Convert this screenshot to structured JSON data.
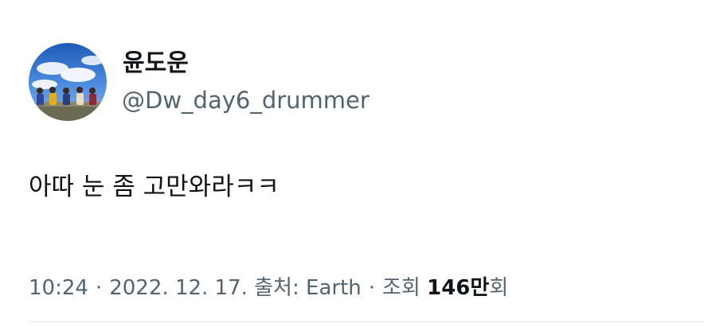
{
  "tweet": {
    "author": {
      "display_name": "윤도운",
      "handle": "@Dw_day6_drummer"
    },
    "text": "아따 눈 좀 고만와라ㅋㅋ",
    "meta": {
      "time": "10:24",
      "date": "2022. 12. 17.",
      "source_label": "출처:",
      "source": "Earth",
      "views_label": "조회",
      "views_count": "146만",
      "views_suffix": "회"
    }
  }
}
